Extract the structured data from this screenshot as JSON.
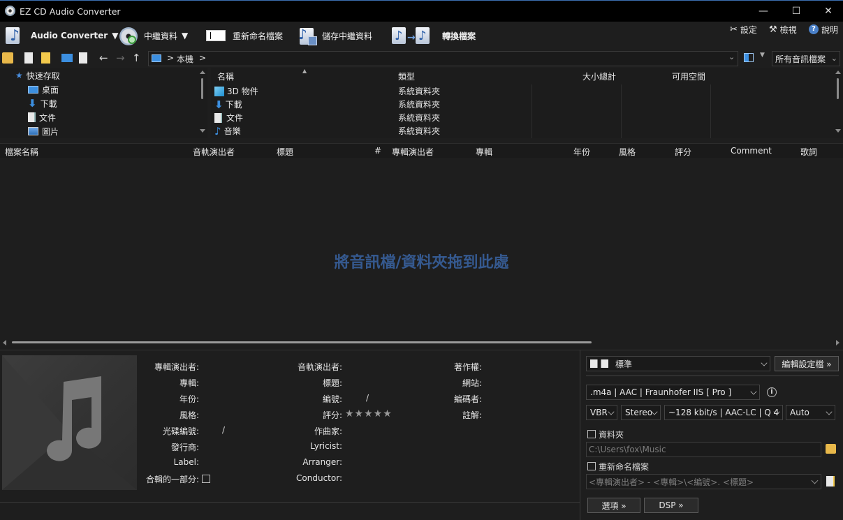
{
  "window": {
    "title": "EZ CD Audio Converter",
    "min": "—",
    "max": "☐",
    "close": "✕"
  },
  "toolbar": {
    "audio_converter": "Audio Converter",
    "metadata": "中繼資料",
    "rename": "重新命名檔案",
    "save_metadata": "儲存中繼資料",
    "convert": "轉換檔案",
    "settings": "設定",
    "view": "檢視",
    "help": "說明"
  },
  "nav": {
    "path": "本機",
    "sep1": ">",
    "sep2": ">",
    "filter": "所有音訊檔案"
  },
  "tree": {
    "items": [
      {
        "label": "快速存取"
      },
      {
        "label": "桌面"
      },
      {
        "label": "下載"
      },
      {
        "label": "文件"
      },
      {
        "label": "圖片"
      }
    ]
  },
  "files": {
    "headers": {
      "name": "名稱",
      "type": "類型",
      "size": "大小總計",
      "free": "可用空間"
    },
    "rows": [
      {
        "name": "3D 物件",
        "type": "系統資料夾"
      },
      {
        "name": "下載",
        "type": "系統資料夾"
      },
      {
        "name": "文件",
        "type": "系統資料夾"
      },
      {
        "name": "音樂",
        "type": "系統資料夾"
      }
    ]
  },
  "tracklist": {
    "headers": [
      "檔案名稱",
      "音軌演出者",
      "標題",
      "#",
      "專輯演出者",
      "專輯",
      "年份",
      "風格",
      "評分",
      "Comment",
      "歌詞"
    ],
    "drop_hint": "將音訊檔/資料夾拖到此處"
  },
  "metadata": {
    "col1": [
      "專輯演出者:",
      "專輯:",
      "年份:",
      "風格:",
      "光碟編號:",
      "發行商:",
      "Label:",
      "合輯的一部分:"
    ],
    "col2": [
      "音軌演出者:",
      "標題:",
      "編號:",
      "評分:",
      "作曲家:",
      "Lyricist:",
      "Arranger:",
      "Conductor:"
    ],
    "col3": [
      "著作權:",
      "網站:",
      "編碼者:",
      "註解:"
    ],
    "disc_slash": "/",
    "track_slash": "/",
    "stars": "★★★★★"
  },
  "output": {
    "profile": "標準",
    "edit_profile": "編輯設定檔 »",
    "format": ".m4a  |  AAC  |  Fraunhofer IIS [ Pro ]",
    "mode": "VBR",
    "channels": "Stereo",
    "quality": "~128 kbit/s | AAC-LC | Q 4",
    "rate": "Auto",
    "folder_label": "資料夾",
    "folder_path": "C:\\Users\\fox\\Music",
    "rename_label": "重新命名檔案",
    "rename_pattern": "<專輯演出者> - <專輯>\\<編號>. <標題>",
    "options": "選項 »",
    "dsp": "DSP »"
  }
}
